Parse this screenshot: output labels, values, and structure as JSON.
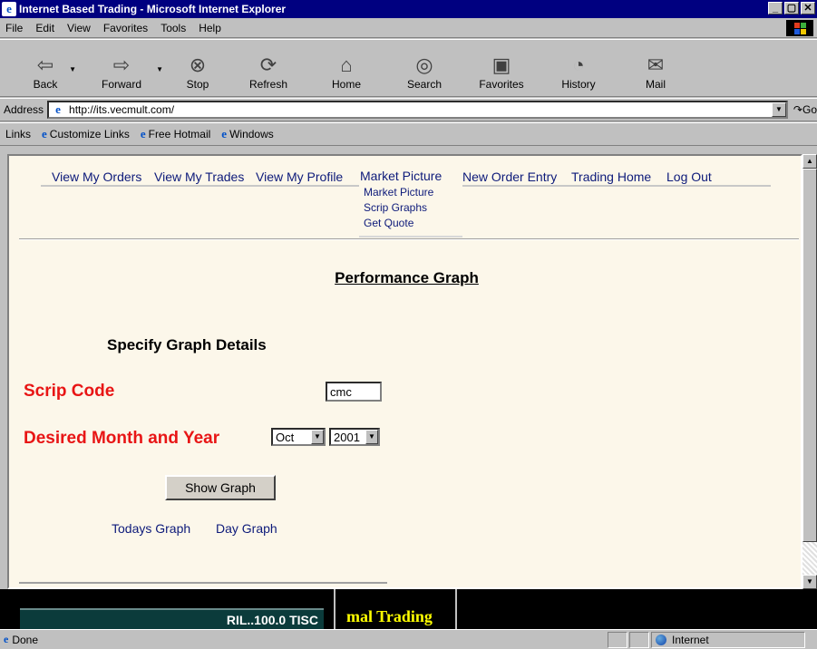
{
  "window": {
    "title": "Internet Based Trading - Microsoft Internet Explorer",
    "controls": [
      "_",
      "▢",
      "✕"
    ]
  },
  "menubar": {
    "items": [
      "File",
      "Edit",
      "View",
      "Favorites",
      "Tools",
      "Help"
    ]
  },
  "toolbar": {
    "buttons": [
      {
        "label": "Back",
        "icon": "back-arrow-icon"
      },
      {
        "label": "Forward",
        "icon": "forward-arrow-icon"
      },
      {
        "label": "Stop",
        "icon": "stop-icon"
      },
      {
        "label": "Refresh",
        "icon": "refresh-icon"
      },
      {
        "label": "Home",
        "icon": "home-icon"
      },
      {
        "label": "Search",
        "icon": "search-icon"
      },
      {
        "label": "Favorites",
        "icon": "favorites-icon"
      },
      {
        "label": "History",
        "icon": "history-icon"
      },
      {
        "label": "Mail",
        "icon": "mail-icon"
      }
    ]
  },
  "address": {
    "label": "Address",
    "url": "http://its.vecmult.com/",
    "go_label": "Go"
  },
  "links": {
    "label": "Links",
    "items": [
      "Customize Links",
      "Free Hotmail",
      "Windows"
    ]
  },
  "page": {
    "nav": {
      "view_orders": "View My Orders",
      "view_trades": "View My Trades",
      "view_profile": "View My Profile",
      "market_picture": "Market Picture",
      "new_order": "New Order Entry",
      "trading_home": "Trading Home",
      "log_out": "Log Out"
    },
    "submenu": [
      "Market Picture",
      "Scrip Graphs",
      "Get Quote"
    ],
    "title": "Performance Graph",
    "section_heading": "Specify Graph Details",
    "scrip_label": "Scrip Code",
    "scrip_value": "cmc",
    "month_year_label": "Desired Month and Year",
    "month_value": "Oct",
    "year_value": "2001",
    "show_button": "Show Graph",
    "todays_graph": "Todays Graph",
    "day_graph": "Day Graph"
  },
  "lower_frame": {
    "ticker_text": "RIL..100.0   TISC",
    "brand_text": "mal Trading"
  },
  "status": {
    "text": "Done",
    "zone": "Internet"
  },
  "colors": {
    "titlebar": "#000080",
    "content_bg": "#fcf7ea",
    "label_red": "#e81515",
    "link_blue": "#0d1a7a",
    "brand_yellow": "#ffff00"
  }
}
